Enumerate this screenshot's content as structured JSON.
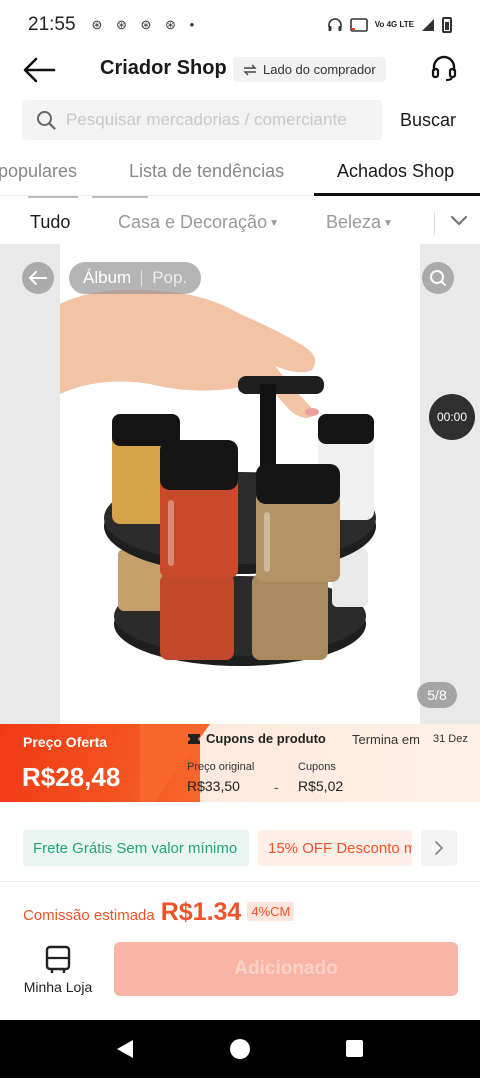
{
  "status_bar": {
    "time": "21:55",
    "notifications": "⊛ ⊛ ⊛ ⊛ •",
    "network": "Vo 4G LTE"
  },
  "header": {
    "title": "Criador Shop",
    "side_switch_label": "Lado do comprador"
  },
  "search": {
    "placeholder": "Pesquisar mercadorias / comerciante",
    "button_label": "Buscar"
  },
  "tabs": [
    {
      "label": "populares"
    },
    {
      "label": "Lista de tendências"
    },
    {
      "label": "Achados Shop"
    }
  ],
  "categories": [
    {
      "label": "Tudo"
    },
    {
      "label": "Casa e Decoração"
    },
    {
      "label": "Beleza"
    }
  ],
  "media": {
    "album_label": "Álbum",
    "pop_label": "Pop.",
    "video_time": "00:00",
    "page_indicator": "5/8"
  },
  "price": {
    "offer_label": "Preço Oferta",
    "offer_price": "R$28,48",
    "coupon_title": "Cupons de produto",
    "ends_label": "Termina em",
    "ends_date": "31 Dez",
    "original_label": "Preço original",
    "original_value": "R$33,50",
    "minus": "-",
    "coupons_label": "Cupons",
    "coupons_value": "R$5,02"
  },
  "promos": [
    {
      "label": "Frete Grátis Sem valor mínimo"
    },
    {
      "label": "15% OFF Desconto m"
    }
  ],
  "commission": {
    "label": "Comissão estimada",
    "value": "R$1.34",
    "badge": "4%CM"
  },
  "bottom": {
    "store_label": "Minha Loja",
    "add_button_label": "Adicionado"
  },
  "colors": {
    "accent": "#f0522a",
    "offer_gradient_start": "#f03a17",
    "promo_green": "#27a27d",
    "add_button_disabled": "#f8b5a6"
  }
}
